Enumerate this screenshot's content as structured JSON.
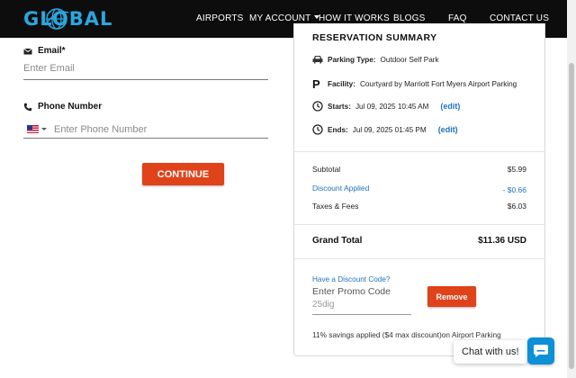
{
  "brand": {
    "logo_text": "GLOBAL",
    "accent": "#2aa7df"
  },
  "nav": {
    "items": [
      {
        "label": "AIRPORTS"
      },
      {
        "label": "MY ACCOUNT",
        "has_dropdown": true
      },
      {
        "label": "HOW IT WORKS"
      },
      {
        "label": "BLOGS"
      },
      {
        "label": "FAQ"
      },
      {
        "label": "CONTACT US"
      }
    ]
  },
  "form": {
    "email": {
      "label": "Email*",
      "icon": "envelope-icon",
      "placeholder": "Enter Email",
      "value": ""
    },
    "phone": {
      "label": "Phone Number",
      "icon": "phone-icon",
      "country": "US",
      "placeholder": "Enter Phone Number",
      "value": ""
    },
    "continue_label": "CONTINUE"
  },
  "summary": {
    "title": "RESERVATION SUMMARY",
    "parking_type": {
      "label": "Parking Type:",
      "value": "Outdoor Self Park"
    },
    "facility": {
      "label": "Facility:",
      "value": "Courtyard by Marriott Fort Myers Airport Parking"
    },
    "starts": {
      "label": "Starts:",
      "value": "Jul 09, 2025 10:45 AM",
      "edit": "(edit)"
    },
    "ends": {
      "label": "Ends:",
      "value": "Jul 09, 2025 01:45 PM",
      "edit": "(edit)"
    },
    "subtotal": {
      "label": "Subtotal",
      "value": "$5.99"
    },
    "discount": {
      "label": "Discount Applied",
      "value": "- $0.66"
    },
    "taxes": {
      "label": "Taxes & Fees",
      "value": "$6.03"
    },
    "grand_total": {
      "label": "Grand Total",
      "value": "$11.36 USD"
    },
    "promo": {
      "link": "Have a Discount Code?",
      "label": "Enter Promo Code",
      "value": "25dig",
      "remove_label": "Remove"
    },
    "savings_text": "11% savings applied ($4 max discount)on Airport Parking"
  },
  "chat": {
    "label": "Chat with us!"
  },
  "colors": {
    "primary_button": "#e0421a",
    "link": "#1e73be",
    "chat": "#0c90d6"
  }
}
